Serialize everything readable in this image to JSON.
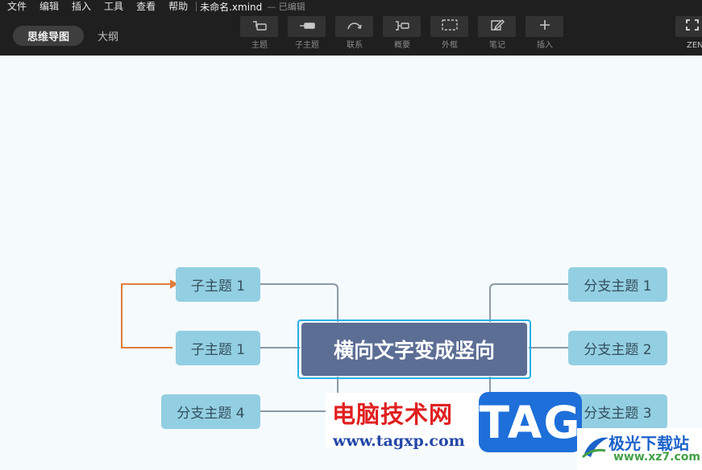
{
  "menu": [
    "文件",
    "编辑",
    "插入",
    "工具",
    "查看",
    "帮助"
  ],
  "file": {
    "title": "未命名.xmind",
    "status": "— 已编辑"
  },
  "view_tabs": {
    "mindmap": "思维导图",
    "outline": "大纲"
  },
  "toolbar": {
    "topic": "主题",
    "subtopic": "子主题",
    "relationship": "联系",
    "summary": "概要",
    "boundary": "外框",
    "note": "笔记",
    "insert": "插入",
    "zen": "ZEN"
  },
  "icons": {
    "topic": "topic-icon",
    "subtopic": "subtopic-icon",
    "relationship": "relationship-icon",
    "summary": "summary-icon",
    "boundary": "boundary-icon",
    "note": "note-icon",
    "insert": "plus-icon",
    "zen": "fullscreen-icon"
  },
  "map": {
    "central": "横向文字变成竖向",
    "left": [
      "子主题 1",
      "子主题 1",
      "分支主题 4"
    ],
    "right": [
      "分支主题 1",
      "分支主题 2",
      "分支主题 3"
    ]
  },
  "colors": {
    "toolbar_bg": "#1f1f1f",
    "canvas_bg": "#f5fafd",
    "central_bg": "#5c6e94",
    "central_selection": "#28b1e8",
    "branch_bg": "#93cfe2",
    "connector": "#8a9aa6",
    "relationship": "#e07d3c"
  },
  "watermark": {
    "title": "电脑技术网",
    "url": "www.tagxp.com",
    "tag": "TAG",
    "site_name": "极光下载站",
    "site_url": "www.xz7.com"
  }
}
